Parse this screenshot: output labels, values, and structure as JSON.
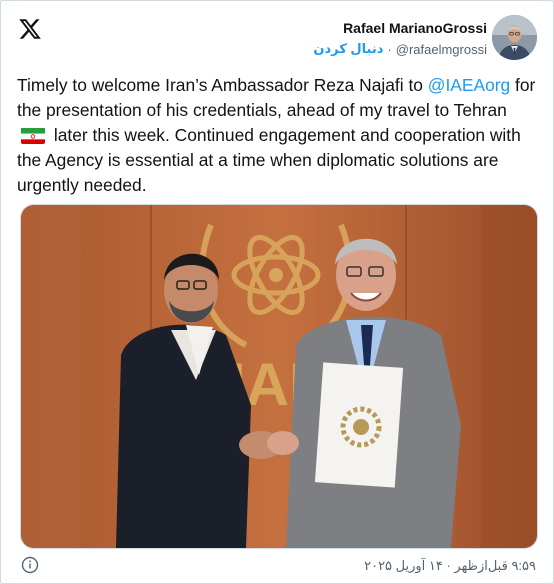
{
  "author": {
    "name": "Rafael MarianoGrossi",
    "handle": "@rafaelmgrossi",
    "follow_label": "دنبال کردن",
    "separator": "·"
  },
  "tweet": {
    "text_part1": "Timely to welcome Iran’s Ambassador Reza Najafi to",
    "mention": "@IAEAorg",
    "text_part2": " for the presentation of his credentials, ahead of my travel to Tehran",
    "text_part3": "later this week. Continued engagement and cooperation with the Agency is essential at a time when diplomatic solutions are urgently needed.",
    "flag_icon": "iran-flag-icon"
  },
  "photo": {
    "wall_letters": "IAE"
  },
  "footer": {
    "timestamp": "۹:۵۹ قبل‌ازظهر · ۱۴ آوریل ۲۰۲۵",
    "info_icon": "info-icon"
  },
  "colors": {
    "link": "#1d9bf0",
    "text": "#0f1419",
    "muted": "#536471"
  }
}
